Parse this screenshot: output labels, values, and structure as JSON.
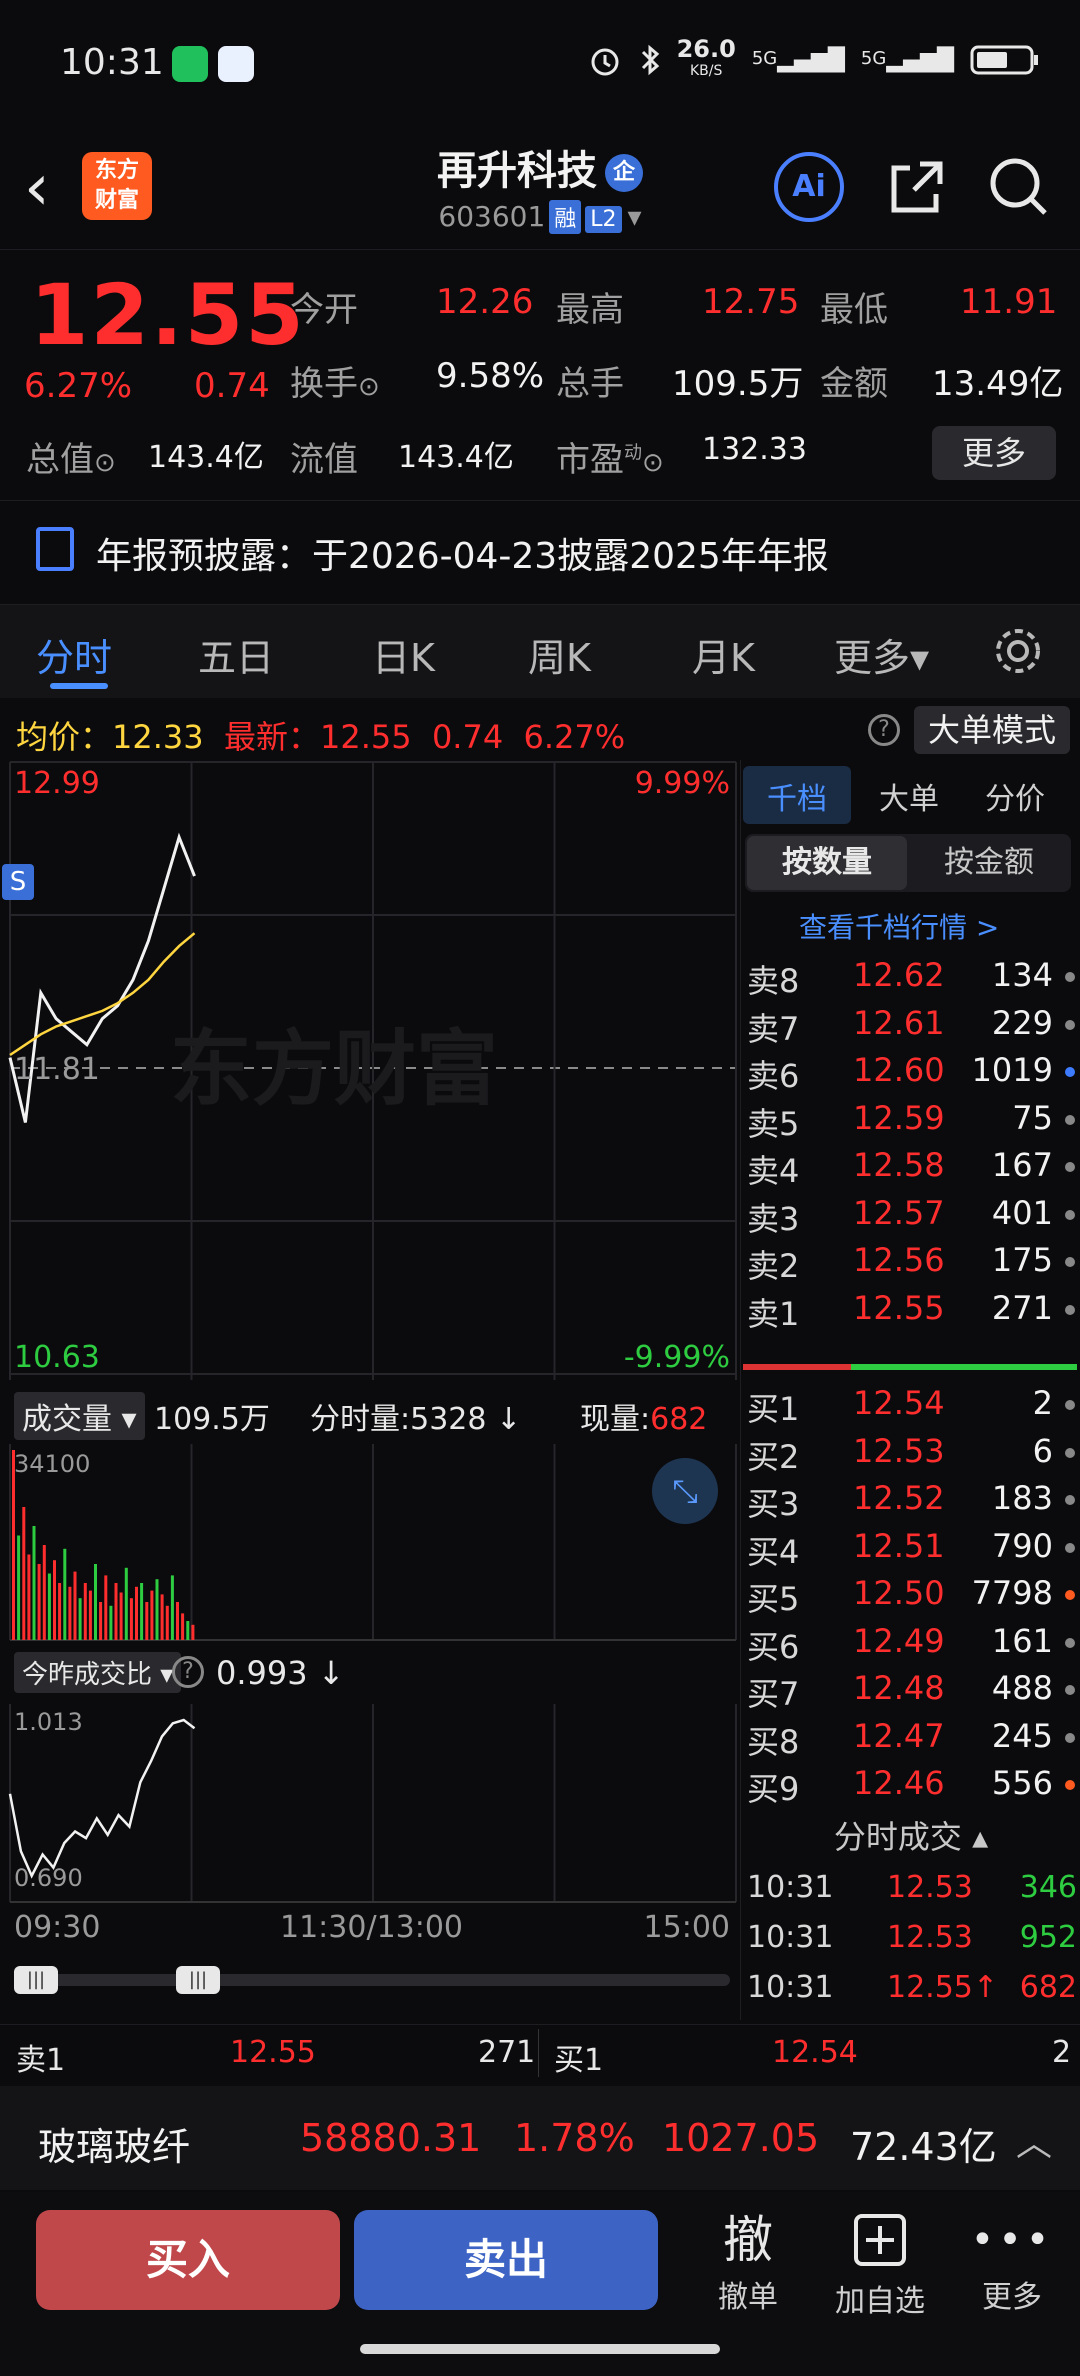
{
  "status": {
    "time": "10:31",
    "speed": "26.0",
    "speed_unit": "KB/S",
    "net1": "5G",
    "net2": "5G"
  },
  "header": {
    "name": "再升科技",
    "badge": "企",
    "code": "603601",
    "tag1": "融",
    "tag2": "L2",
    "ai": "Ai",
    "logo_line1": "东方",
    "logo_line2": "财富"
  },
  "quote": {
    "price": "12.55",
    "change_pct": "6.27%",
    "change_val": "0.74",
    "open_label": "今开",
    "open": "12.26",
    "high_label": "最高",
    "high": "12.75",
    "low_label": "最低",
    "low": "11.91",
    "turnover_label": "换手",
    "turnover": "9.58%",
    "volume_label": "总手",
    "volume": "109.5万",
    "amount_label": "金额",
    "amount": "13.49亿",
    "mktcap_label": "总值",
    "mktcap": "143.4亿",
    "float_label": "流值",
    "float": "143.4亿",
    "pe_label": "市盈",
    "pe_sup": "动",
    "pe": "132.33",
    "more": "更多"
  },
  "notice": {
    "text": "年报预披露：于2026-04-23披露2025年年报"
  },
  "tabs": [
    "分时",
    "五日",
    "日K",
    "周K",
    "月K",
    "更多▾"
  ],
  "strip": {
    "avg_label": "均价：",
    "avg": "12.33",
    "latest_label": "最新：",
    "latest": "12.55",
    "chg": "0.74",
    "pct": "6.27%",
    "mode": "大单模式"
  },
  "chart": {
    "top_price": "12.99",
    "top_pct": "9.99%",
    "mid_price": "11.81",
    "bottom_price": "10.63",
    "bottom_pct": "-9.99%",
    "watermark": "东方财富",
    "marker": "S",
    "vol_label": "成交量",
    "vol_total": "109.5万",
    "minute_vol": "分时量:5328",
    "now_vol_label": "现量:",
    "now_vol": "682",
    "vol_max": "34100",
    "ratio_label": "今昨成交比",
    "ratio": "0.993",
    "ratio_max": "1.013",
    "ratio_min": "0.690",
    "t_start": "09:30",
    "t_mid": "11:30/13:00",
    "t_end": "15:00"
  },
  "chart_data": {
    "type": "line",
    "title": "",
    "xlabel": "",
    "ylabel": "",
    "ylim": [
      10.63,
      12.99
    ],
    "x": [
      "09:30",
      "09:35",
      "09:40",
      "09:45",
      "09:50",
      "09:55",
      "10:00",
      "10:05",
      "10:10",
      "10:15",
      "10:20",
      "10:25",
      "10:31"
    ],
    "series": [
      {
        "name": "",
        "values": [
          11.85,
          11.6,
          12.1,
          12.0,
          11.95,
          11.9,
          12.0,
          12.05,
          12.15,
          12.3,
          12.5,
          12.7,
          12.55
        ]
      },
      {
        "name": "均价",
        "values": [
          11.86,
          11.9,
          11.94,
          11.97,
          11.99,
          12.01,
          12.03,
          12.06,
          12.1,
          12.15,
          12.22,
          12.28,
          12.33
        ]
      }
    ]
  },
  "book": {
    "tabs": [
      "千档",
      "大单",
      "分价"
    ],
    "sub1": "按数量",
    "sub2": "按金额",
    "link": "查看千档行情 >",
    "asks": [
      {
        "lbl": "卖8",
        "p": "12.62",
        "v": "134",
        "dot": "#888888"
      },
      {
        "lbl": "卖7",
        "p": "12.61",
        "v": "229",
        "dot": "#888888"
      },
      {
        "lbl": "卖6",
        "p": "12.60",
        "v": "1019",
        "dot": "#3d7bff"
      },
      {
        "lbl": "卖5",
        "p": "12.59",
        "v": "75",
        "dot": "#888888"
      },
      {
        "lbl": "卖4",
        "p": "12.58",
        "v": "167",
        "dot": "#888888"
      },
      {
        "lbl": "卖3",
        "p": "12.57",
        "v": "401",
        "dot": "#888888"
      },
      {
        "lbl": "卖2",
        "p": "12.56",
        "v": "175",
        "dot": "#888888"
      },
      {
        "lbl": "卖1",
        "p": "12.55",
        "v": "271",
        "dot": "#888888"
      }
    ],
    "bids": [
      {
        "lbl": "买1",
        "p": "12.54",
        "v": "2",
        "dot": "#888888"
      },
      {
        "lbl": "买2",
        "p": "12.53",
        "v": "6",
        "dot": "#888888"
      },
      {
        "lbl": "买3",
        "p": "12.52",
        "v": "183",
        "dot": "#888888"
      },
      {
        "lbl": "买4",
        "p": "12.51",
        "v": "790",
        "dot": "#888888"
      },
      {
        "lbl": "买5",
        "p": "12.50",
        "v": "7798",
        "dot": "#ff5a1f"
      },
      {
        "lbl": "买6",
        "p": "12.49",
        "v": "161",
        "dot": "#888888"
      },
      {
        "lbl": "买7",
        "p": "12.48",
        "v": "488",
        "dot": "#888888"
      },
      {
        "lbl": "买8",
        "p": "12.47",
        "v": "245",
        "dot": "#888888"
      },
      {
        "lbl": "买9",
        "p": "12.46",
        "v": "556",
        "dot": "#ff5a1f"
      }
    ],
    "trades_title": "分时成交",
    "trades": [
      {
        "t": "10:31",
        "p": "12.53",
        "v": "346",
        "vc": "#2ecc40"
      },
      {
        "t": "10:31",
        "p": "12.53",
        "v": "952",
        "vc": "#2ecc40"
      },
      {
        "t": "10:31",
        "p": "12.55↑",
        "v": "682",
        "vc": "#ff2e2e"
      }
    ]
  },
  "bottom_quote": {
    "sell_lbl": "卖1",
    "sell_p": "12.55",
    "sell_v": "271",
    "buy_lbl": "买1",
    "buy_p": "12.54",
    "buy_v": "2"
  },
  "index_bar": {
    "name": "玻璃玻纤",
    "value": "58880.31",
    "pct": "1.78%",
    "chg": "1027.05",
    "amount": "72.43亿"
  },
  "actions": {
    "buy": "买入",
    "sell": "卖出",
    "cancel_glyph": "撤",
    "cancel": "撤单",
    "watch": "加自选",
    "more": "更多"
  },
  "colors": {
    "up": "#ff2e2e",
    "down": "#2ecc40",
    "avg": "#ffd640",
    "accent": "#4a8fff"
  }
}
